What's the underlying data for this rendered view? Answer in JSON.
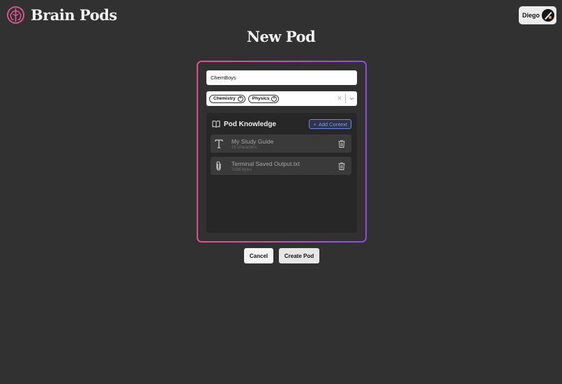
{
  "app": {
    "title": "Brain Pods",
    "brand_color": "#d9568f"
  },
  "user": {
    "name": "Diego"
  },
  "page": {
    "title": "New Pod"
  },
  "form": {
    "pod_name_value": "ChemBoys",
    "tags": [
      {
        "label": "Chemistry"
      },
      {
        "label": "Physics"
      }
    ],
    "clear_symbol": "×"
  },
  "knowledge": {
    "title": "Pod Knowledge",
    "add_label": "Add Context",
    "items": [
      {
        "name": "My Study Guide",
        "meta": "18 characters",
        "icon": "text-icon"
      },
      {
        "name": "Terminal Saved Output.txt",
        "meta": "7096 bytes",
        "icon": "paperclip-icon"
      }
    ]
  },
  "actions": {
    "cancel_label": "Cancel",
    "create_label": "Create Pod"
  },
  "colors": {
    "gradient_start": "#d9568f",
    "gradient_end": "#8a4fd8",
    "accent_blue": "#7e9be0"
  }
}
